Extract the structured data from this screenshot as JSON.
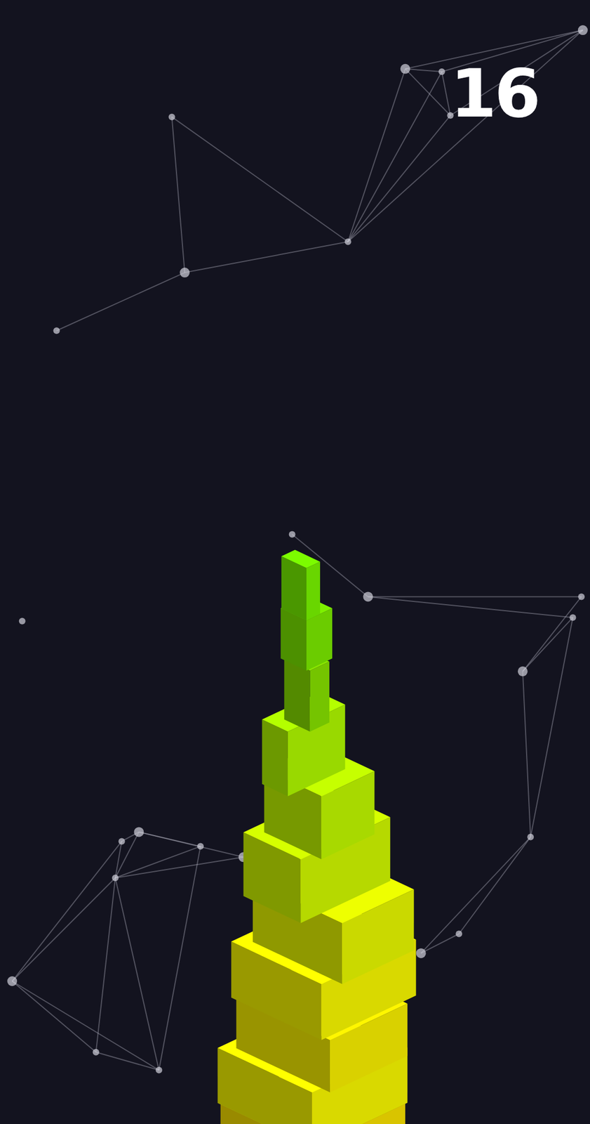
{
  "score": "16",
  "blocks": [
    {
      "color": "#7cfc00"
    },
    {
      "color": "#7ef000"
    },
    {
      "color": "#8ae600"
    },
    {
      "color": "#b4ff00"
    },
    {
      "color": "#c6ff00"
    },
    {
      "color": "#d6ff00"
    },
    {
      "color": "#eeff00"
    },
    {
      "color": "#ffff00"
    },
    {
      "color": "#fff600"
    },
    {
      "color": "#ffff00"
    },
    {
      "color": "#ffe600"
    }
  ]
}
